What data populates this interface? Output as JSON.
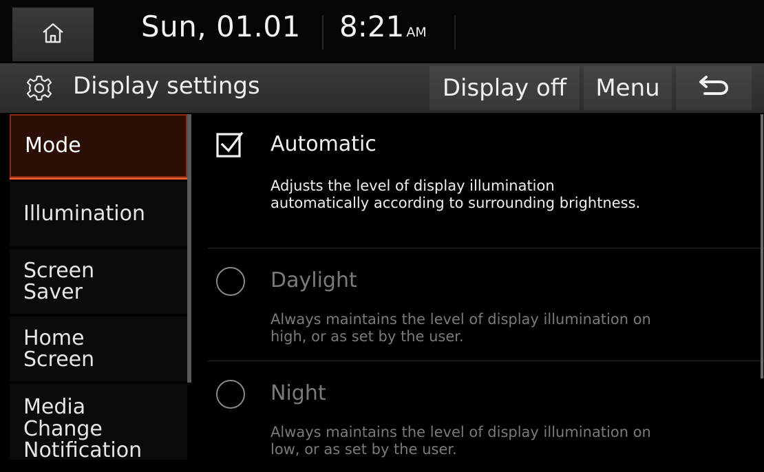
{
  "status_bar": {
    "home_icon": "home-icon",
    "date": "Sun, 01.01",
    "time": "8:21",
    "ampm": "AM"
  },
  "title_bar": {
    "icon": "gear-icon",
    "title": "Display settings",
    "display_off_label": "Display off",
    "menu_label": "Menu",
    "back_icon": "back-arrow-icon"
  },
  "sidebar": {
    "items": [
      {
        "label": "Mode",
        "active": true
      },
      {
        "label": "Illumination"
      },
      {
        "label": "Screen Saver"
      },
      {
        "label": "Home Screen"
      },
      {
        "label": "Media Change Notification"
      }
    ]
  },
  "options": [
    {
      "label": "Automatic",
      "description": "Adjusts the level of display illumination automatically according to surrounding brightness.",
      "control": "checkbox",
      "checked": true,
      "enabled": true
    },
    {
      "label": "Daylight",
      "description": "Always maintains the level of display illumination on high, or as set by the user.",
      "control": "radio",
      "checked": false,
      "enabled": false
    },
    {
      "label": "Night",
      "description": "Always maintains the level of display illumination on low, or as set by the user.",
      "control": "radio",
      "checked": false,
      "enabled": false
    }
  ],
  "colors": {
    "accent": "#e05a2a",
    "active_bg": "#2c0f04",
    "disabled_text": "#7a7a7a"
  }
}
